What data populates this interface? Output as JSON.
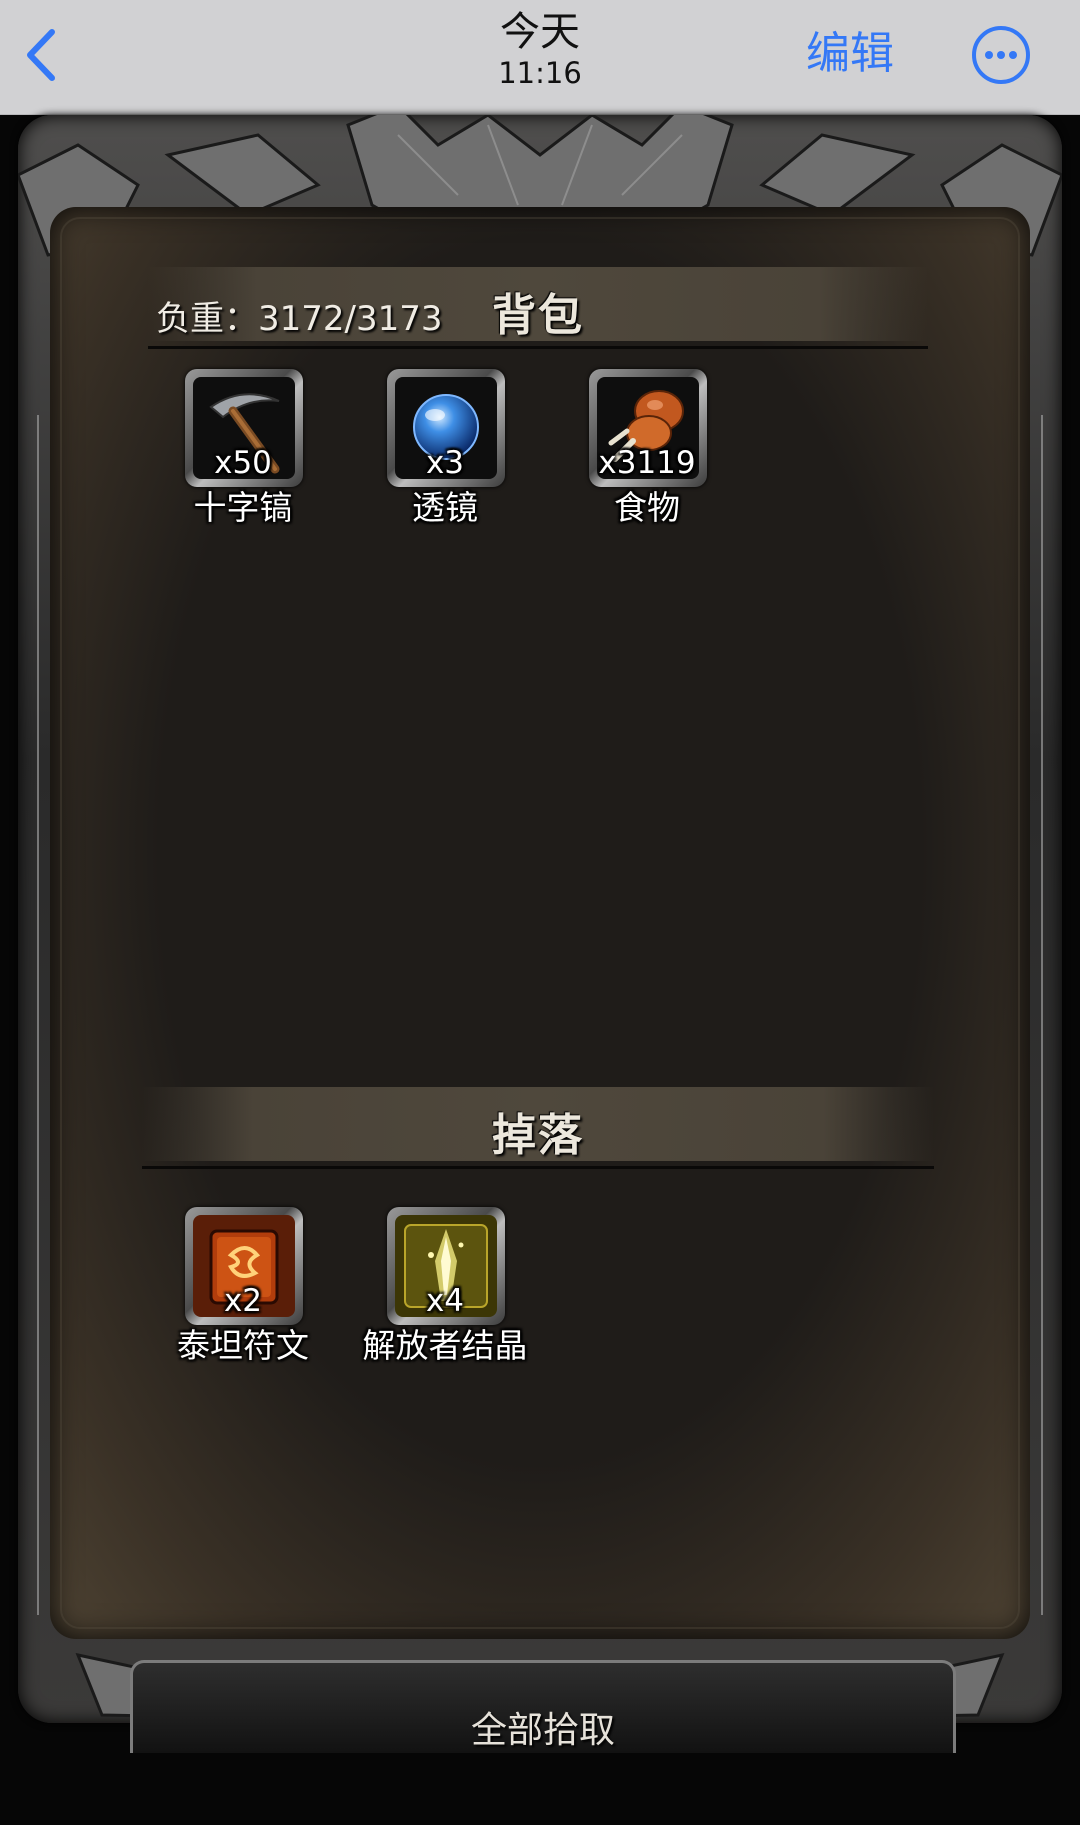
{
  "topbar": {
    "title": "今天",
    "time": "11:16",
    "edit_label": "编辑",
    "accent_color": "#3478f6"
  },
  "backpack": {
    "weight_label": "负重：3172/3173",
    "title": "背包",
    "items": [
      {
        "icon": "pickaxe-icon",
        "count": "x50",
        "name": "十字镐"
      },
      {
        "icon": "lens-orb-icon",
        "count": "x3",
        "name": "透镜"
      },
      {
        "icon": "drumstick-icon",
        "count": "x3119",
        "name": "食物"
      }
    ]
  },
  "drops": {
    "title": "掉落",
    "items": [
      {
        "icon": "titan-rune-icon",
        "count": "x2",
        "name": "泰坦符文"
      },
      {
        "icon": "liberator-crystal-icon",
        "count": "x4",
        "name": "解放者结晶"
      }
    ]
  },
  "pickup_button": {
    "label": "全部拾取"
  }
}
